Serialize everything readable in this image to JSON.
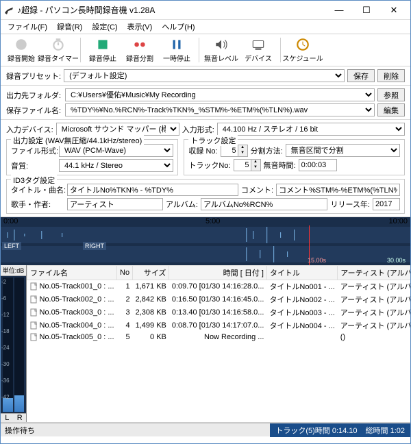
{
  "window": {
    "title": "♪超録 - パソコン長時間録音機 v1.28A"
  },
  "menu": {
    "file": "ファイル(F)",
    "rec": "録音(R)",
    "set": "設定(C)",
    "view": "表示(V)",
    "help": "ヘルプ(H)"
  },
  "toolbar": {
    "recStart": "録音開始",
    "recTimer": "録音タイマー",
    "recStop": "録音停止",
    "recSplit": "録音分割",
    "pause": "一時停止",
    "silence": "無音レベル",
    "device": "デバイス",
    "schedule": "スケジュール"
  },
  "preset": {
    "label": "録音プリセット:",
    "value": "(デフォルト設定)",
    "save": "保存",
    "delete": "削除"
  },
  "out": {
    "folderLabel": "出力先フォルダ:",
    "folder": "C:¥Users¥優佑¥Music¥My Recording",
    "browse": "参照",
    "fileLabel": "保存ファイル名:",
    "file": "%TDY%¥No.%RCN%-Track%TKN%_%STM%-%ETM%(%TLN%).wav",
    "edit": "編集"
  },
  "input": {
    "deviceLabel": "入力デバイス:",
    "device": "Microsoft サウンド マッパー (標準)",
    "fmtLabel": "入力形式:",
    "fmt": "44.100 Hz / ステレオ / 16 bit"
  },
  "outset": {
    "groupTitle": "出力設定 (WAV無圧縮/44.1kHz/stereo)",
    "fmtLabel": "ファイル形式:",
    "fmt": "WAV (PCM-Wave)",
    "qLabel": "音質:",
    "q": "44.1 kHz / Stereo"
  },
  "trackset": {
    "groupTitle": "トラック設定",
    "recNoLabel": "収録 No:",
    "recNo": "5",
    "splitLabel": "分割方法:",
    "split": "無音区間で分割",
    "trackNoLabel": "トラックNo:",
    "trackNo": "5",
    "silenceLabel": "無音時間:",
    "silence": "0:00:03"
  },
  "id3": {
    "groupTitle": "ID3タグ設定",
    "titleLabel": "タイトル・曲名:",
    "title": "タイトルNo%TKN% - %TDY%",
    "commentLabel": "コメント:",
    "comment": "コメント%STM%-%ETM%(%TLN%)",
    "artistLabel": "歌手・作者:",
    "artist": "アーティスト",
    "albumLabel": "アルバム:",
    "album": "アルバムNo%RCN%",
    "yearLabel": "リリース年:",
    "year": "2017"
  },
  "wave": {
    "t0": "0:00",
    "t5": "5:00",
    "t10": "10:00",
    "left": "LEFT",
    "right": "RIGHT",
    "t15": "15.00s",
    "t30": "30.00s"
  },
  "meter": {
    "unit": "単位:dB",
    "L": "L",
    "R": "R",
    "ticks": [
      "-2",
      "-6",
      "-12",
      "-18",
      "-24",
      "-30",
      "-36",
      "-42"
    ]
  },
  "table": {
    "cols": {
      "fname": "ファイル名",
      "no": "No",
      "size": "サイズ",
      "time": "時間 [ 日付 ]",
      "title": "タイトル",
      "artist": "アーティスト (アルバ"
    },
    "rows": [
      {
        "fname": "No.05-Track001_0 : ...",
        "no": "1",
        "size": "1,671 KB",
        "time": "0:09.70 [01/30 14:16:28.0...",
        "title": "タイトルNo001 - ...",
        "artist": "アーティスト (アルバ"
      },
      {
        "fname": "No.05-Track002_0 : ...",
        "no": "2",
        "size": "2,842 KB",
        "time": "0:16.50 [01/30 14:16:45.0...",
        "title": "タイトルNo002 - ...",
        "artist": "アーティスト (アルバ"
      },
      {
        "fname": "No.05-Track003_0 : ...",
        "no": "3",
        "size": "2,308 KB",
        "time": "0:13.40 [01/30 14:16:58.0...",
        "title": "タイトルNo003 - ...",
        "artist": "アーティスト (アルバ"
      },
      {
        "fname": "No.05-Track004_0 : ...",
        "no": "4",
        "size": "1,499 KB",
        "time": "0:08.70 [01/30 14:17:07.0...",
        "title": "タイトルNo004 - ...",
        "artist": "アーティスト (アルバ"
      },
      {
        "fname": "No.05-Track005_0 : ...",
        "no": "5",
        "size": "0 KB",
        "time": "Now Recording ...",
        "title": "",
        "artist": "()"
      }
    ]
  },
  "status": {
    "left": "操作待ち",
    "track": "トラック(5)時間 0:14.10",
    "total": "総時間 1:02"
  }
}
